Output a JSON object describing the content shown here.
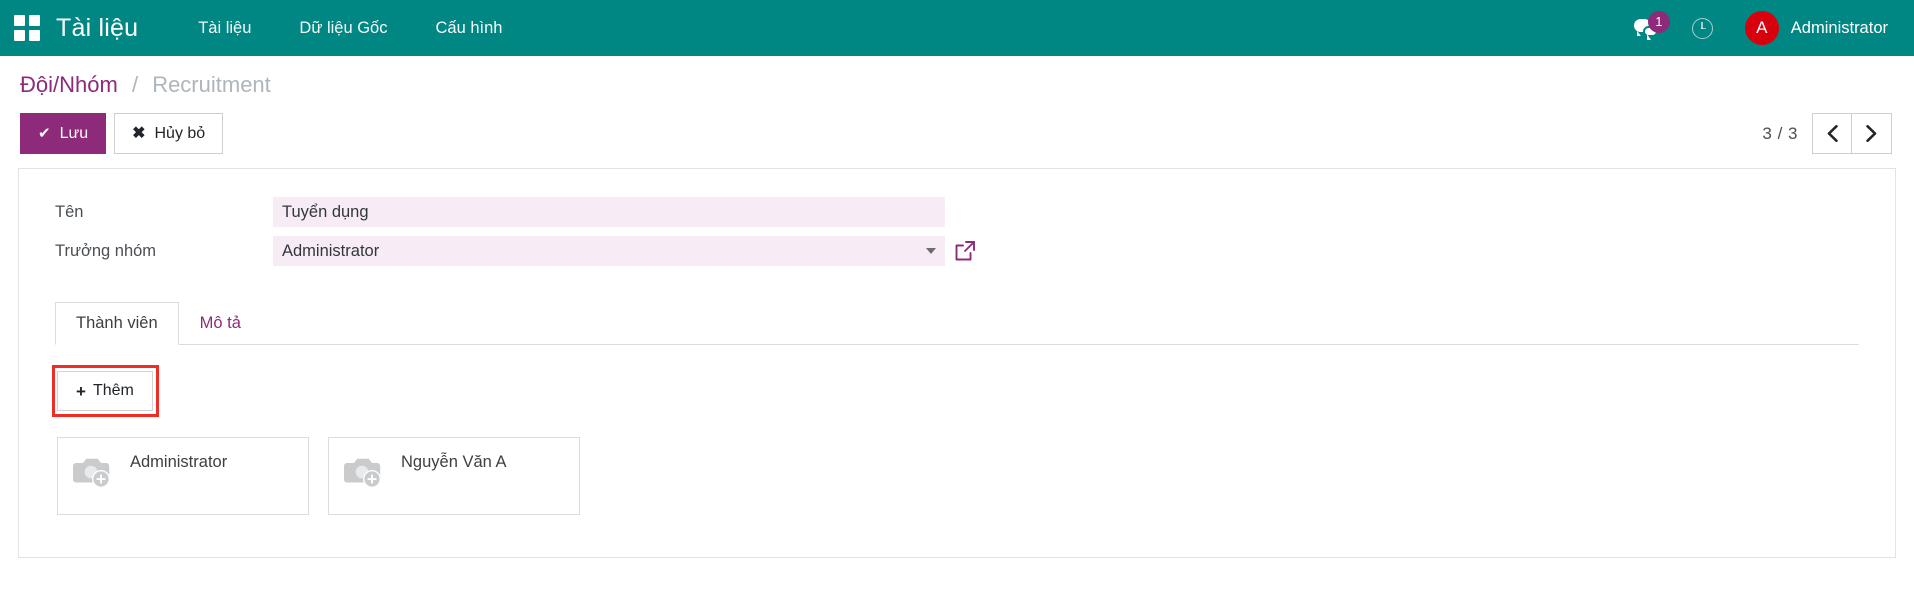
{
  "navbar": {
    "apps_icon": "apps-grid-icon",
    "brand": "Tài liệu",
    "menu": [
      {
        "label": "Tài liệu"
      },
      {
        "label": "Dữ liệu Gốc"
      },
      {
        "label": "Cấu hình"
      }
    ],
    "messaging": {
      "icon": "chat-bubbles-icon",
      "badge_count": "1"
    },
    "activities": {
      "icon": "clock-icon"
    },
    "user": {
      "avatar_initial": "A",
      "name": "Administrator"
    },
    "bg_color": "#008784"
  },
  "breadcrumb": {
    "parent": "Đội/Nhóm",
    "separator": "/",
    "current": "Recruitment"
  },
  "control_panel": {
    "save_label": "Lưu",
    "discard_label": "Hủy bỏ",
    "save_icon": "check-icon",
    "discard_icon": "times-icon",
    "save_color": "#8e2a7a",
    "pager": {
      "count": "3 / 3",
      "previous_icon": "chevron-left-icon",
      "next_icon": "chevron-right-icon"
    }
  },
  "form": {
    "fields": [
      {
        "label": "Tên",
        "value": "Tuyển dụng",
        "placeholder": "",
        "type": "text"
      },
      {
        "label": "Trưởng nhóm",
        "value": "Administrator",
        "placeholder": "",
        "type": "many2one",
        "caret_icon": "chevron-down-icon",
        "external_icon": "external-link-icon"
      }
    ],
    "input_bg": "#f7ecf6"
  },
  "notebook": {
    "tabs": [
      {
        "label": "Thành viên",
        "active": true
      },
      {
        "label": "Mô tả",
        "active": false
      }
    ],
    "add_button": {
      "label": "Thêm",
      "icon": "plus-icon",
      "highlight_color": "#ee2e24"
    },
    "members": [
      {
        "name": "Administrator",
        "avatar_icon": "camera-placeholder-icon"
      },
      {
        "name": "Nguyễn Văn A",
        "avatar_icon": "camera-placeholder-icon"
      }
    ]
  }
}
